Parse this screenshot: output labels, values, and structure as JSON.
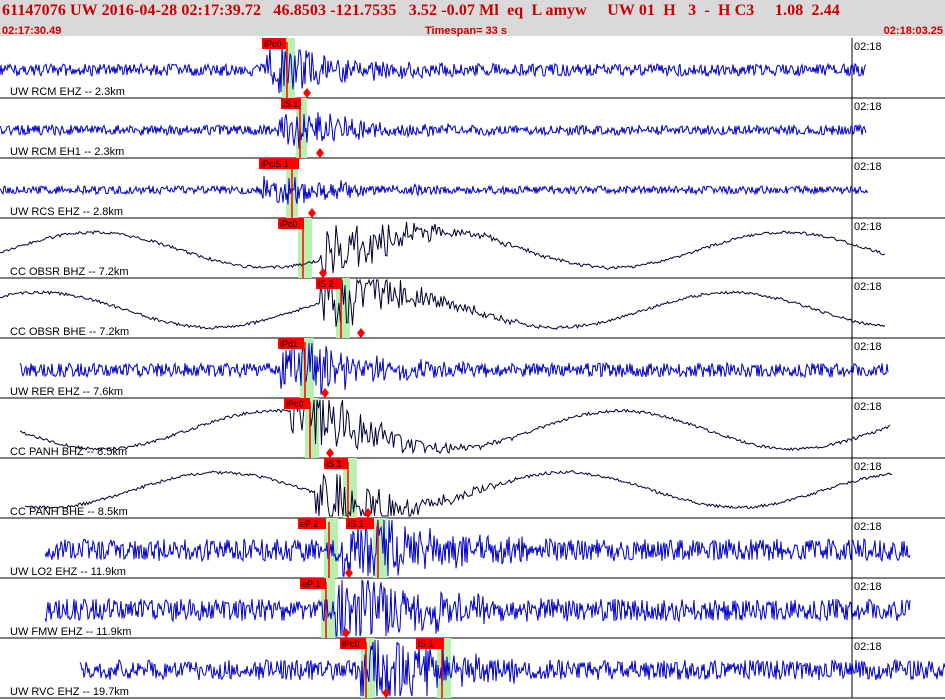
{
  "header": {
    "title": "61147076 UW 2016-04-28 02:17:39.72   46.8503 -121.7535   3.52 -0.07 Ml  eq  L amyw     UW 01  H   3  -  H C3     1.08  2.44",
    "start_time": "02:17:30.49",
    "timespan": "Timespan=  33 s",
    "end_time": "02:18:03.25"
  },
  "tick_label": "02:18",
  "colors": {
    "header_bg": "#d9d9d9",
    "header_text": "#cc0000",
    "pick_box": "#ff0000",
    "window": "#b8f0b0",
    "trace_blue": "#0000cc",
    "trace_black": "#000033"
  },
  "channels": [
    {
      "label": "UW RCM EHZ -- 2.3km",
      "color": "blue",
      "picks": [
        {
          "text": "iPc0"
        }
      ]
    },
    {
      "label": "UW RCM EH1 -- 2.3km",
      "color": "blue",
      "picks": [
        {
          "text": "iS 1"
        }
      ]
    },
    {
      "label": "UW RCS EHZ -- 2.8km",
      "color": "blue",
      "picks": [
        {
          "text": "iPciS 1"
        }
      ]
    },
    {
      "label": "CC OBSR BHZ -- 7.2km",
      "color": "black",
      "picks": [
        {
          "text": "iPc0"
        }
      ]
    },
    {
      "label": "CC OBSR BHE -- 7.2km",
      "color": "black",
      "picks": [
        {
          "text": "iS 2"
        }
      ]
    },
    {
      "label": "UW RER EHZ -- 7.6km",
      "color": "blue",
      "picks": [
        {
          "text": "iPd1"
        }
      ]
    },
    {
      "label": "CC PANH BHZ -- 8.5km",
      "color": "black",
      "picks": [
        {
          "text": "iPc0"
        }
      ]
    },
    {
      "label": "CC PANH BHE -- 8.5km",
      "color": "black",
      "picks": [
        {
          "text": "iS 1"
        }
      ]
    },
    {
      "label": "UW LO2 EHZ -- 11.9km",
      "color": "blue",
      "picks": [
        {
          "text": "eP 2"
        },
        {
          "text": "iS 1"
        }
      ]
    },
    {
      "label": "UW FMW EHZ -- 11.9km",
      "color": "blue",
      "picks": [
        {
          "text": "eP 1"
        }
      ]
    },
    {
      "label": "UW RVC EHZ -- 19.7km",
      "color": "blue",
      "picks": [
        {
          "text": "iPc0"
        },
        {
          "text": "iS 1"
        }
      ]
    }
  ]
}
